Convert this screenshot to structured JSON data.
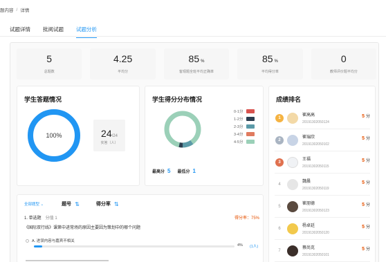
{
  "breadcrumb": {
    "parent": "题内容",
    "separator": "/",
    "current": "详情"
  },
  "tabs": [
    {
      "label": "试题详情",
      "active": false
    },
    {
      "label": "批阅试题",
      "active": false
    },
    {
      "label": "试题分析",
      "active": true
    }
  ],
  "stats": [
    {
      "value": "5",
      "unit": "",
      "label": "总题数"
    },
    {
      "value": "4.25",
      "unit": "",
      "label": "平均分"
    },
    {
      "value": "85",
      "unit": "%",
      "label": "客观题全班平均正确率"
    },
    {
      "value": "85",
      "unit": "%",
      "label": "平均得分率"
    },
    {
      "value": "0",
      "unit": "",
      "label": "教师评价题平均分"
    }
  ],
  "answer_card": {
    "title": "学生答题情况",
    "rate_percent": 100,
    "rate_label": "100%",
    "actual": "24",
    "total": "/24",
    "actual_label": "实答（人）",
    "ring_color": "#2196f3"
  },
  "dist_card": {
    "title": "学生得分分布情况",
    "legend": [
      {
        "label": "0-1分",
        "color": "#d9534f"
      },
      {
        "label": "1-2分",
        "color": "#2c3e50"
      },
      {
        "label": "2-3分",
        "color": "#5b9aa8"
      },
      {
        "label": "3-4分",
        "color": "#e07b5f"
      },
      {
        "label": "4-5分",
        "color": "#9bd0b8"
      }
    ],
    "highest_label": "最高分",
    "highest": "5",
    "lowest_label": "最低分",
    "lowest": "1"
  },
  "ranking": {
    "title": "成绩排名",
    "score_unit": "分",
    "rows": [
      {
        "rank": "1",
        "name": "崔高高",
        "id": "20191302050124",
        "score": "5",
        "avatar": "#f3d9a7"
      },
      {
        "rank": "2",
        "name": "崔瑞欣",
        "id": "20191302050102",
        "score": "5",
        "avatar": "#c8d4e6"
      },
      {
        "rank": "3",
        "name": "王福",
        "id": "20191302050115",
        "score": "5",
        "avatar": "#f0f2f5"
      },
      {
        "rank": "4",
        "name": "魏晨",
        "id": "20191302050119",
        "score": "5",
        "avatar": "#e6e6e6"
      },
      {
        "rank": "5",
        "name": "崔朋德",
        "id": "20191302050123",
        "score": "5",
        "avatar": "#5a4a3f"
      },
      {
        "rank": "6",
        "name": "杨卓廷",
        "id": "20191302050120",
        "score": "5",
        "avatar": "#f2c94c"
      },
      {
        "rank": "7",
        "name": "蔡尚克",
        "id": "20191302050101",
        "score": "5",
        "avatar": "#3b2f2a"
      }
    ]
  },
  "detail": {
    "filter_label": "全部题型",
    "sort_by_number": "题号",
    "sort_by_score": "得分率",
    "question_type": "1. 单选题",
    "question_meta": "分值 1",
    "score_rate_label": "得分率：75%",
    "question_text": "《国际双行线》课第中进常场的原因主要因为策划中的哪个问题",
    "option_a": "A. 进误内容与嘉宾不相关",
    "option_a_percent": 4,
    "option_a_percent_label": "4%",
    "option_a_count": "(1人)"
  }
}
